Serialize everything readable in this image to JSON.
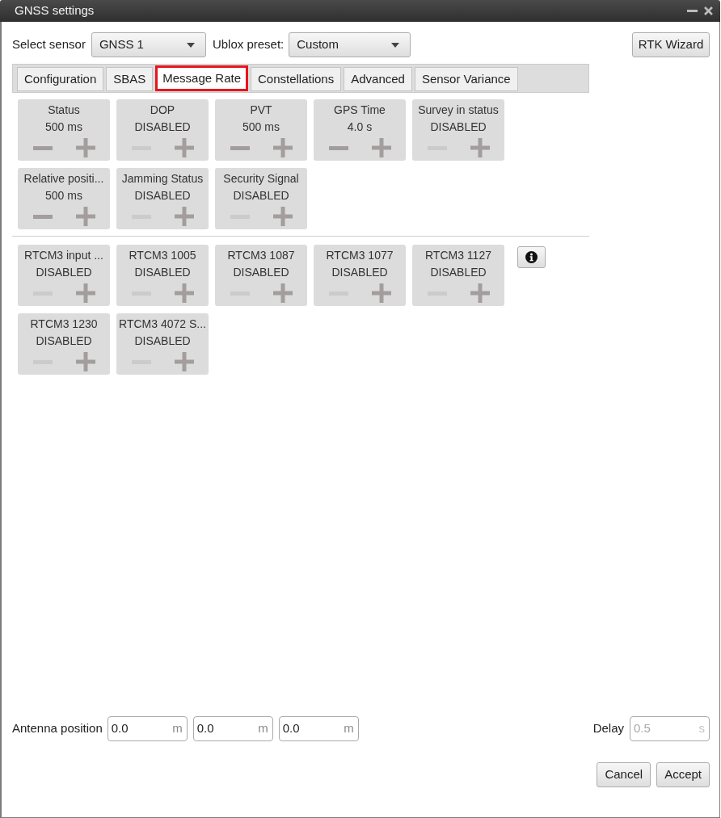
{
  "window": {
    "title": "GNSS settings"
  },
  "toolbar": {
    "sensor_label": "Select sensor",
    "sensor": "GNSS 1",
    "preset_label": "Ublox preset:",
    "preset": "Custom",
    "rtk_button": "RTK Wizard"
  },
  "tabs": [
    {
      "label": "Configuration",
      "selected": false
    },
    {
      "label": "SBAS",
      "selected": false
    },
    {
      "label": "Message Rate",
      "selected": true
    },
    {
      "label": "Constellations",
      "selected": false
    },
    {
      "label": "Advanced",
      "selected": false
    },
    {
      "label": "Sensor Variance",
      "selected": false
    }
  ],
  "ubx_messages": [
    {
      "name": "Status",
      "value": "500 ms",
      "decrease_enabled": true
    },
    {
      "name": "DOP",
      "value": "DISABLED",
      "decrease_enabled": false
    },
    {
      "name": "PVT",
      "value": "500 ms",
      "decrease_enabled": true
    },
    {
      "name": "GPS Time",
      "value": "4.0 s",
      "decrease_enabled": true
    },
    {
      "name": "Survey in status",
      "value": "DISABLED",
      "decrease_enabled": false
    },
    {
      "name": "Relative positi...",
      "value": "500 ms",
      "decrease_enabled": true
    },
    {
      "name": "Jamming Status",
      "value": "DISABLED",
      "decrease_enabled": false
    },
    {
      "name": "Security Signal",
      "value": "DISABLED",
      "decrease_enabled": false
    }
  ],
  "rtcm_messages": [
    {
      "name": "RTCM3 input ...",
      "value": "DISABLED",
      "decrease_enabled": false
    },
    {
      "name": "RTCM3 1005",
      "value": "DISABLED",
      "decrease_enabled": false
    },
    {
      "name": "RTCM3 1087",
      "value": "DISABLED",
      "decrease_enabled": false
    },
    {
      "name": "RTCM3 1077",
      "value": "DISABLED",
      "decrease_enabled": false
    },
    {
      "name": "RTCM3 1127",
      "value": "DISABLED",
      "decrease_enabled": false
    },
    {
      "name": "RTCM3 1230",
      "value": "DISABLED",
      "decrease_enabled": false
    },
    {
      "name": "RTCM3 4072 S...",
      "value": "DISABLED",
      "decrease_enabled": false
    }
  ],
  "antenna": {
    "label": "Antenna position",
    "fields": [
      {
        "value": "0.0",
        "unit": "m",
        "disabled": false
      },
      {
        "value": "0.0",
        "unit": "m",
        "disabled": false
      },
      {
        "value": "0.0",
        "unit": "m",
        "disabled": false
      }
    ]
  },
  "delay": {
    "label": "Delay",
    "value": "0.5",
    "unit": "s",
    "disabled": true
  },
  "buttons": [
    "Cancel",
    "Accept"
  ]
}
